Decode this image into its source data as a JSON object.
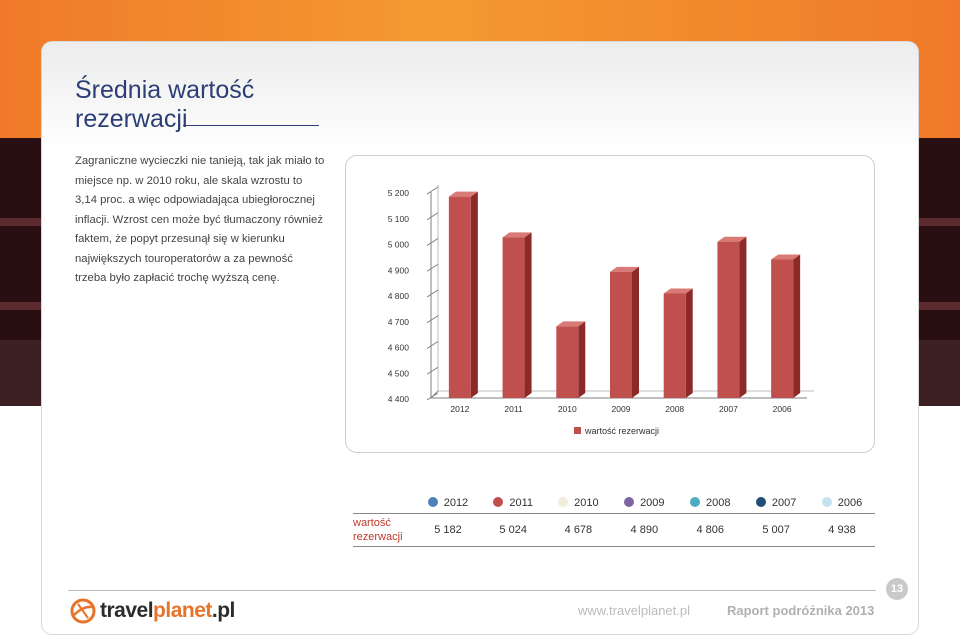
{
  "title": "Średnia wartość rezerwacji",
  "body_text": "Zagraniczne wycieczki nie tanieją, tak jak miało to miejsce np. w 2010 roku, ale skala wzrostu to 3,14 proc. a więc odpowiadająca ubiegłorocznej inflacji. Wzrost cen może być tłumaczony również faktem, że popyt przesunął się w kierunku największych touroperatorów a za pewność trzeba było zapłacić trochę wyższą cenę.",
  "chart_data": {
    "type": "bar",
    "categories": [
      "2012",
      "2011",
      "2010",
      "2009",
      "2008",
      "2007",
      "2006"
    ],
    "series": [
      {
        "name": "wartość rezerwacji",
        "values": [
          5182,
          5024,
          4678,
          4890,
          4806,
          5007,
          4938
        ]
      }
    ],
    "ylim": [
      4400,
      5200
    ],
    "yticks": [
      "5 200",
      "5 100",
      "5 000",
      "4 900",
      "4 800",
      "4 700",
      "4 600",
      "4 500",
      "4 400"
    ],
    "legend_position": "bottom",
    "bar_color": "#c0504d"
  },
  "table": {
    "row_label": "wartość rezerwacji",
    "columns": [
      {
        "year": "2012",
        "color": "#4f81bd",
        "value": "5 182"
      },
      {
        "year": "2011",
        "color": "#c0504d",
        "value": "5 024"
      },
      {
        "year": "2010",
        "color": "#f2ecd8",
        "value": "4 678"
      },
      {
        "year": "2009",
        "color": "#8064a2",
        "value": "4 890"
      },
      {
        "year": "2008",
        "color": "#4bacc6",
        "value": "4 806"
      },
      {
        "year": "2007",
        "color": "#1f4e79",
        "value": "5 007"
      },
      {
        "year": "2006",
        "color": "#c6e2f0",
        "value": "4 938"
      }
    ]
  },
  "footer": {
    "page_number": "13",
    "logo_main": "travel",
    "logo_accent": "planet",
    "logo_suffix": ".pl",
    "url": "www.travelplanet.pl",
    "report": "Raport podróżnika 2013"
  }
}
